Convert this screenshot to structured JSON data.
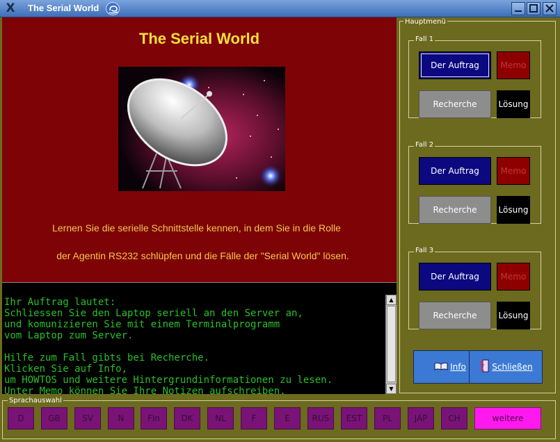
{
  "window": {
    "title": "The Serial World",
    "logo_glyph": "X"
  },
  "content": {
    "heading": "The Serial World",
    "intro_line1": "Lernen Sie die serielle Schnittstelle kennen, in dem Sie in die Rolle",
    "intro_line2": "der Agentin RS232 schlüpfen und die Fälle der \"Serial World\" lösen."
  },
  "terminal": {
    "lines": [
      "Ihr Auftrag lautet:",
      "Schliessen Sie den Laptop seriell an den Server an,",
      "und komunizieren Sie mit einem Terminalprogramm",
      "vom Laptop zum Server.",
      "",
      "Hilfe zum Fall gibts bei Recherche.",
      "Klicken Sie auf Info,",
      "um HOWTOS und weitere Hintergrundinformationen zu lesen.",
      "Unter Memo können Sie Ihre Notizen aufschreiben."
    ]
  },
  "menu": {
    "title": "Hauptmenü",
    "cases": [
      {
        "label": "Fall 1",
        "auftrag": "Der Auftrag",
        "memo": "Memo",
        "recherche": "Recherche",
        "loesung": "Lösung"
      },
      {
        "label": "Fall 2",
        "auftrag": "Der Auftrag",
        "memo": "Memo",
        "recherche": "Recherche",
        "loesung": "Lösung"
      },
      {
        "label": "Fall 3",
        "auftrag": "Der Auftrag",
        "memo": "Memo",
        "recherche": "Recherche",
        "loesung": "Lösung"
      }
    ],
    "info_label": "Info",
    "close_label": "Schließen"
  },
  "languages": {
    "title": "Sprachauswahl",
    "items": [
      "D",
      "GB",
      "SV",
      "N",
      "FIn",
      "DK",
      "NL",
      "F",
      "E",
      "RUS",
      "EST",
      "PL",
      "JAP",
      "CH"
    ],
    "more": "weitere"
  },
  "colors": {
    "panel": "#7e0306",
    "heading": "#f7e03b",
    "terminal_text": "#28c028",
    "menu_bg": "#6b6a1f",
    "auftrag_btn": "#0b0880",
    "lang_btn": "#7a1377",
    "more_btn": "#ff19ef"
  }
}
